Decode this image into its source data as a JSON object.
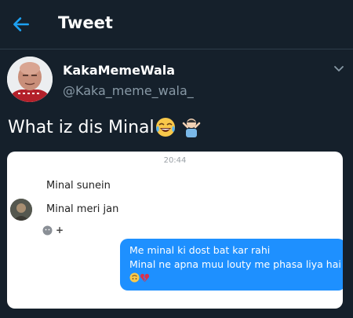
{
  "header": {
    "title": "Tweet"
  },
  "author": {
    "name": "KakaMemeWala",
    "handle": "@Kaka_meme_wala_"
  },
  "tweet": {
    "text": "What iz dis Minal"
  },
  "chat": {
    "timestamp": "20:44",
    "incoming": [
      "Minal sunein",
      "Minal meri jan"
    ],
    "reaction_plus": "+",
    "outgoing": {
      "line1": "Me minal ki dost bat kar rahi",
      "line2": "Minal ne apna muu louty me phasa liya hai"
    }
  },
  "colors": {
    "background": "#15202b",
    "accent": "#1da1f2",
    "bubble": "#1e90ff",
    "muted": "#8899a6"
  }
}
